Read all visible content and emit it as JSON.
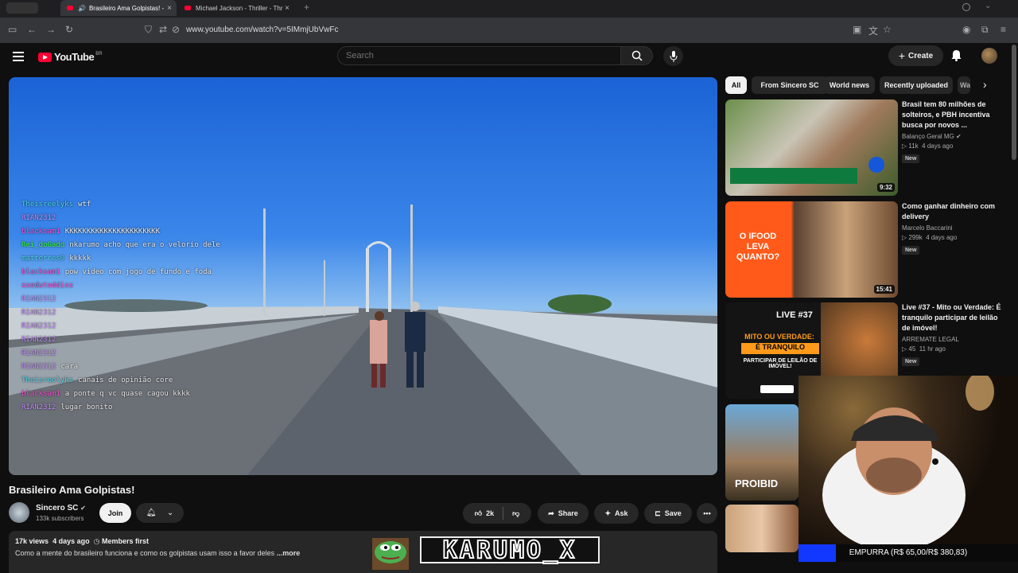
{
  "browser": {
    "tabs": [
      {
        "label": "Brasileiro Ama Golpistas! -",
        "active": true
      },
      {
        "label": "Michael Jackson - Thriller - Thr",
        "active": false
      }
    ],
    "url": "www.youtube.com/watch?v=5IMmjUbVwFc"
  },
  "header": {
    "logo_text": "YouTube",
    "logo_country": "BR",
    "search_placeholder": "Search",
    "create_label": "Create"
  },
  "chat": [
    {
      "user": "Theisreelyks",
      "msg": "wtf",
      "color": "#4ad7e8"
    },
    {
      "user": "RIAN2312",
      "msg": "",
      "color": "#c58cff"
    },
    {
      "user": "blacksam1",
      "msg": "KKKKKKKKKKKKKKKKKKKKKK",
      "color": "#ff4fd8"
    },
    {
      "user": "Rei_doGado",
      "msg": "nkarumo acho que era o velorio dele",
      "color": "#38ff38"
    },
    {
      "user": "mattorres0",
      "msg": "kkkkk",
      "color": "#4ad7e8"
    },
    {
      "user": "blacksam1",
      "msg": "pow video com jogo de fundo e foda",
      "color": "#ff4fd8"
    },
    {
      "user": "xxedutoddixx",
      "msg": "",
      "color": "#ff4fd8"
    },
    {
      "user": "RIAN2312",
      "msg": "",
      "color": "#c58cff"
    },
    {
      "user": "RIAN2312",
      "msg": "",
      "color": "#c58cff"
    },
    {
      "user": "RIAN2312",
      "msg": "",
      "color": "#c58cff"
    },
    {
      "user": "RIAN2312",
      "msg": "",
      "color": "#c58cff"
    },
    {
      "user": "RIAN2312",
      "msg": "",
      "color": "#c58cff"
    },
    {
      "user": "RIAN2312",
      "msg": "cara",
      "color": "#c58cff"
    },
    {
      "user": "Theisreelyks",
      "msg": "canais de opinião core",
      "color": "#4ad7e8"
    },
    {
      "user": "blacksam1",
      "msg": "a ponte q vc quase cagou kkkk",
      "color": "#ff4fd8"
    },
    {
      "user": "RIAN2312",
      "msg": "lugar bonito",
      "color": "#c58cff"
    }
  ],
  "video": {
    "title": "Brasileiro Ama Golpistas!",
    "channel": "Sincero SC",
    "subscribers": "133k subscribers",
    "join_label": "Join",
    "likes": "2k",
    "share_label": "Share",
    "ask_label": "Ask",
    "save_label": "Save",
    "views": "17k views",
    "age": "4 days ago",
    "members": "Members first",
    "description": "Como a mente do brasileiro funciona e como os golpistas usam isso a favor deles",
    "more_label": "...more"
  },
  "chips": [
    "All",
    "From Sincero SC",
    "World news",
    "Recently uploaded",
    "Wa"
  ],
  "recommendations": [
    {
      "title": "Brasil tem 80 milhões de solteiros, e PBH incentiva busca por novos ...",
      "channel": "Balanço Geral MG",
      "views": "11k",
      "age": "4 days ago",
      "badge": "New",
      "duration": "9:32",
      "verified": true
    },
    {
      "title": "Como ganhar dinheiro com delivery",
      "channel": "Marcelo Baccarini",
      "views": "299k",
      "age": "4 days ago",
      "badge": "New",
      "duration": "15:41",
      "thumb_text": "O IFOOD LEVA QUANTO?"
    },
    {
      "title": "Live #37 - Mito ou Verdade: É tranquilo participar de leilão de imóvel!",
      "channel": "ARREMATE LEGAL",
      "views": "45",
      "age": "11 hr ago",
      "badge": "New",
      "thumb_text1": "LIVE #37",
      "thumb_text2": "MITO OU VERDADE:",
      "thumb_text3": "É TRANQUILO",
      "thumb_text4": "PARTICIPAR DE LEILÃO DE IMÓVEL!"
    },
    {
      "thumb_text": "PROIBID"
    }
  ],
  "overlay": {
    "streamer": "KARUMO_X",
    "goal": "EMPURRA (R$ 65,00/R$ 380,83)",
    "goal_progress": 0.17
  }
}
